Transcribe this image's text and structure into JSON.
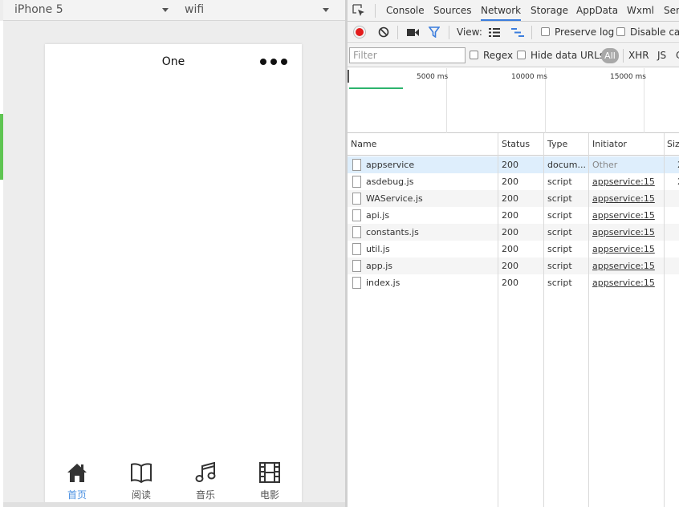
{
  "simulator": {
    "device": "iPhone 5",
    "network": "wifi",
    "page_title": "One",
    "tabs": [
      {
        "label": "首页",
        "icon": "home-icon",
        "active": true
      },
      {
        "label": "阅读",
        "icon": "book-icon",
        "active": false
      },
      {
        "label": "音乐",
        "icon": "music-icon",
        "active": false
      },
      {
        "label": "电影",
        "icon": "film-icon",
        "active": false
      }
    ],
    "active_color": "#4a90e2"
  },
  "devtools": {
    "tabs": [
      "Console",
      "Sources",
      "Network",
      "Storage",
      "AppData",
      "Wxml",
      "Sen"
    ],
    "active_tab": "Network",
    "toolbar": {
      "view_label": "View:",
      "preserve_log": "Preserve log",
      "disable_cache": "Disable cac"
    },
    "filter": {
      "placeholder": "Filter",
      "regex": "Regex",
      "hide_data_urls": "Hide data URLs",
      "all": "All",
      "xhr": "XHR",
      "js": "JS",
      "more": "C"
    },
    "timeline": {
      "labels": [
        "5000 ms",
        "10000 ms",
        "15000 ms"
      ]
    },
    "columns": {
      "name": "Name",
      "status": "Status",
      "type": "Type",
      "initiator": "Initiator",
      "size": "Siz"
    },
    "rows": [
      {
        "name": "appservice",
        "status": "200",
        "type": "docum...",
        "initiator": "Other",
        "size": "2"
      },
      {
        "name": "asdebug.js",
        "status": "200",
        "type": "script",
        "initiator": "appservice:15",
        "size": "2"
      },
      {
        "name": "WAService.js",
        "status": "200",
        "type": "script",
        "initiator": "appservice:15",
        "size": ""
      },
      {
        "name": "api.js",
        "status": "200",
        "type": "script",
        "initiator": "appservice:15",
        "size": ""
      },
      {
        "name": "constants.js",
        "status": "200",
        "type": "script",
        "initiator": "appservice:15",
        "size": ""
      },
      {
        "name": "util.js",
        "status": "200",
        "type": "script",
        "initiator": "appservice:15",
        "size": ""
      },
      {
        "name": "app.js",
        "status": "200",
        "type": "script",
        "initiator": "appservice:15",
        "size": ""
      },
      {
        "name": "index.js",
        "status": "200",
        "type": "script",
        "initiator": "appservice:15",
        "size": ""
      }
    ],
    "record_color": "#e31c1c",
    "accent_color": "#3b7ddd"
  }
}
